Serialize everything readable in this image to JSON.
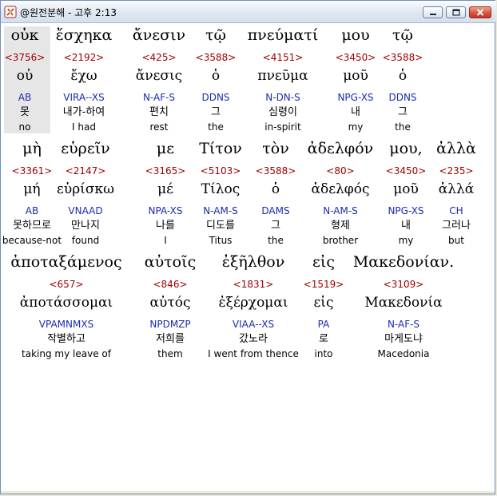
{
  "window": {
    "title": "@원전분해 - 고후 2:13"
  },
  "rows": [
    {
      "words": [
        {
          "greek": "οὐκ",
          "strong": "<3756>",
          "lemma": "οὐ",
          "parse": "AB",
          "korean": "못",
          "english": "no"
        },
        {
          "greek": "ἔσχηκα",
          "strong": "<2192>",
          "lemma": "ἔχω",
          "parse": "VIRA--XS",
          "korean": "내가-하여",
          "english": "I had"
        },
        {
          "greek": "ἄνεσιν",
          "strong": "<425>",
          "lemma": "ἄνεσις",
          "parse": "N-AF-S",
          "korean": "편치",
          "english": "rest"
        },
        {
          "greek": "τῷ",
          "strong": "<3588>",
          "lemma": "ὁ",
          "parse": "DDNS",
          "korean": "그",
          "english": "the"
        },
        {
          "greek": "πνεύματί",
          "strong": "<4151>",
          "lemma": "πνεῦμα",
          "parse": "N-DN-S",
          "korean": "심령이",
          "english": "in-spirit"
        },
        {
          "greek": "μου",
          "strong": "<3450>",
          "lemma": "μοῦ",
          "parse": "NPG-XS",
          "korean": "내",
          "english": "my"
        },
        {
          "greek": "τῷ",
          "strong": "<3588>",
          "lemma": "ὁ",
          "parse": "DDNS",
          "korean": "그",
          "english": "the"
        }
      ]
    },
    {
      "words": [
        {
          "greek": "μὴ",
          "strong": "<3361>",
          "lemma": "μή",
          "parse": "AB",
          "korean": "못하므로",
          "english": "because-not"
        },
        {
          "greek": "εὑρεῖν",
          "strong": "<2147>",
          "lemma": "εὑρίσκω",
          "parse": "VNAAD",
          "korean": "만나지",
          "english": "found"
        },
        {
          "greek": "με",
          "strong": "<3165>",
          "lemma": "μέ",
          "parse": "NPA-XS",
          "korean": "나를",
          "english": "I"
        },
        {
          "greek": "Τίτον",
          "strong": "<5103>",
          "lemma": "Τίλος",
          "parse": "N-AM-S",
          "korean": "디도를",
          "english": "Titus"
        },
        {
          "greek": "τὸν",
          "strong": "<3588>",
          "lemma": "ὁ",
          "parse": "DAMS",
          "korean": "그",
          "english": "the"
        },
        {
          "greek": "ἀδελφόν",
          "strong": "<80>",
          "lemma": "ἀδελφός",
          "parse": "N-AM-S",
          "korean": "형제",
          "english": "brother"
        },
        {
          "greek": "μου,",
          "strong": "<3450>",
          "lemma": "μοῦ",
          "parse": "NPG-XS",
          "korean": "내",
          "english": "my"
        },
        {
          "greek": "ἀλλὰ",
          "strong": "<235>",
          "lemma": "ἀλλά",
          "parse": "CH",
          "korean": "그러나",
          "english": "but"
        }
      ]
    },
    {
      "words": [
        {
          "greek": "ἀποταξάμενος",
          "strong": "<657>",
          "lemma": "ἀποτάσσομαι",
          "parse": "VPAMNMXS",
          "korean": "작별하고",
          "english": "taking my leave of"
        },
        {
          "greek": "αὐτοῖς",
          "strong": "<846>",
          "lemma": "αὐτός",
          "parse": "NPDMZP",
          "korean": "저희를",
          "english": "them"
        },
        {
          "greek": "ἐξῆλθον",
          "strong": "<1831>",
          "lemma": "ἐξέρχομαι",
          "parse": "VIAA--XS",
          "korean": "갔노라",
          "english": "I went from thence"
        },
        {
          "greek": "εἰς",
          "strong": "<1519>",
          "lemma": "εἰς",
          "parse": "PA",
          "korean": "로",
          "english": "into"
        },
        {
          "greek": "Μακεδονίαν.",
          "strong": "<3109>",
          "lemma": "Μακεδονία",
          "parse": "N-AF-S",
          "korean": "마게도냐",
          "english": "Macedonia"
        }
      ]
    }
  ]
}
